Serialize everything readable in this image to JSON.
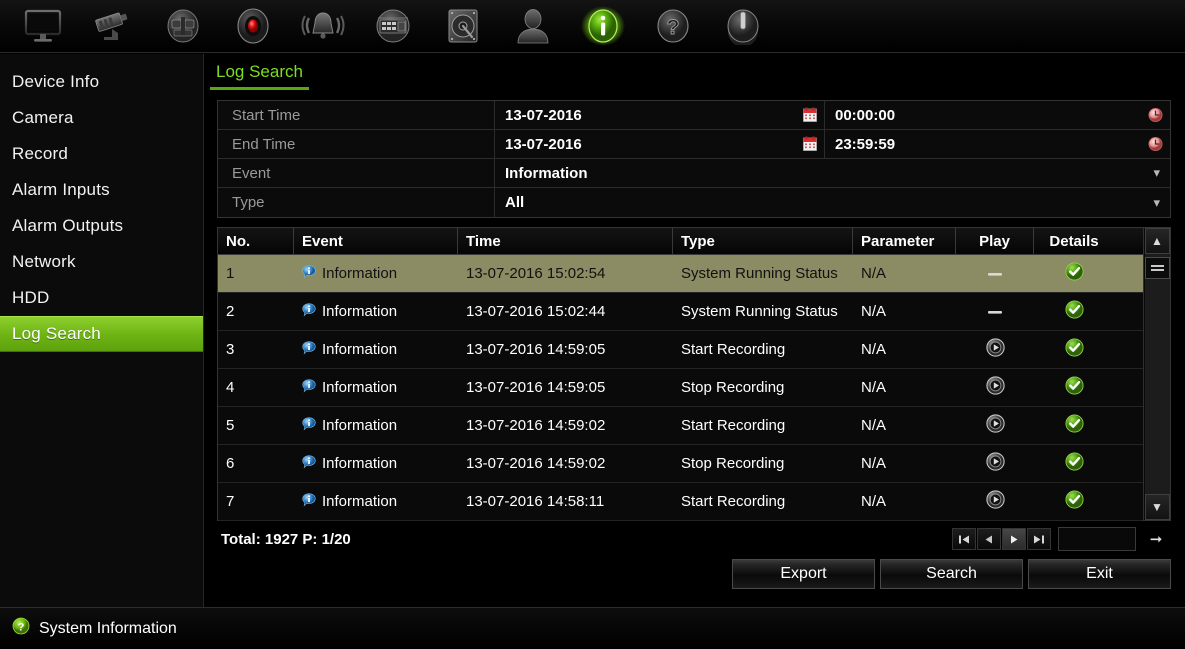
{
  "toolbar": {
    "items": [
      {
        "icon": "monitor-icon",
        "name": "live-view"
      },
      {
        "icon": "camera-icon",
        "name": "camera"
      },
      {
        "icon": "playback-icon",
        "name": "playback"
      },
      {
        "icon": "record-icon",
        "name": "record"
      },
      {
        "icon": "alarm-bell-icon",
        "name": "alarm"
      },
      {
        "icon": "config-icon",
        "name": "configuration"
      },
      {
        "icon": "hdd-icon",
        "name": "hdd"
      },
      {
        "icon": "user-icon",
        "name": "user"
      },
      {
        "icon": "info-icon",
        "name": "maintenance",
        "active": true
      },
      {
        "icon": "help-icon",
        "name": "help"
      },
      {
        "icon": "power-icon",
        "name": "shutdown"
      }
    ]
  },
  "sidebar": {
    "items": [
      {
        "label": "Device Info",
        "active": false
      },
      {
        "label": "Camera",
        "active": false
      },
      {
        "label": "Record",
        "active": false
      },
      {
        "label": "Alarm Inputs",
        "active": false
      },
      {
        "label": "Alarm Outputs",
        "active": false
      },
      {
        "label": "Network",
        "active": false
      },
      {
        "label": "HDD",
        "active": false
      },
      {
        "label": "Log Search",
        "active": true
      }
    ]
  },
  "tab": {
    "label": "Log Search"
  },
  "form": {
    "start_time": {
      "label": "Start Time",
      "date": "13-07-2016",
      "time": "00:00:00"
    },
    "end_time": {
      "label": "End Time",
      "date": "13-07-2016",
      "time": "23:59:59"
    },
    "event": {
      "label": "Event",
      "value": "Information"
    },
    "type": {
      "label": "Type",
      "value": "All"
    }
  },
  "table": {
    "columns": [
      "No.",
      "Event",
      "Time",
      "Type",
      "Parameter",
      "Play",
      "Details"
    ],
    "rows": [
      {
        "no": "1",
        "event": "Information",
        "time": "13-07-2016 15:02:54",
        "type": "System Running Status",
        "parameter": "N/A",
        "play": "none",
        "details": "check",
        "selected": true
      },
      {
        "no": "2",
        "event": "Information",
        "time": "13-07-2016 15:02:44",
        "type": "System Running Status",
        "parameter": "N/A",
        "play": "none",
        "details": "check",
        "selected": false
      },
      {
        "no": "3",
        "event": "Information",
        "time": "13-07-2016 14:59:05",
        "type": "Start Recording",
        "parameter": "N/A",
        "play": "play",
        "details": "check",
        "selected": false
      },
      {
        "no": "4",
        "event": "Information",
        "time": "13-07-2016 14:59:05",
        "type": "Stop Recording",
        "parameter": "N/A",
        "play": "play",
        "details": "check",
        "selected": false
      },
      {
        "no": "5",
        "event": "Information",
        "time": "13-07-2016 14:59:02",
        "type": "Start Recording",
        "parameter": "N/A",
        "play": "play",
        "details": "check",
        "selected": false
      },
      {
        "no": "6",
        "event": "Information",
        "time": "13-07-2016 14:59:02",
        "type": "Stop Recording",
        "parameter": "N/A",
        "play": "play",
        "details": "check",
        "selected": false
      },
      {
        "no": "7",
        "event": "Information",
        "time": "13-07-2016 14:58:11",
        "type": "Start Recording",
        "parameter": "N/A",
        "play": "play",
        "details": "check",
        "selected": false
      }
    ]
  },
  "footer": {
    "total_label": "Total: 1927  P: 1/20",
    "page_input_value": "",
    "buttons": {
      "export": "Export",
      "search": "Search",
      "exit": "Exit"
    }
  },
  "statusbar": {
    "text": "System Information"
  },
  "colors": {
    "accent_green": "#6fb515",
    "tab_green": "#7ddd1f",
    "selected_row": "#8b8b64",
    "info_blue": "#4a9fe0",
    "check_green": "#5aa81a",
    "clock_red": "#e8a0a0"
  }
}
